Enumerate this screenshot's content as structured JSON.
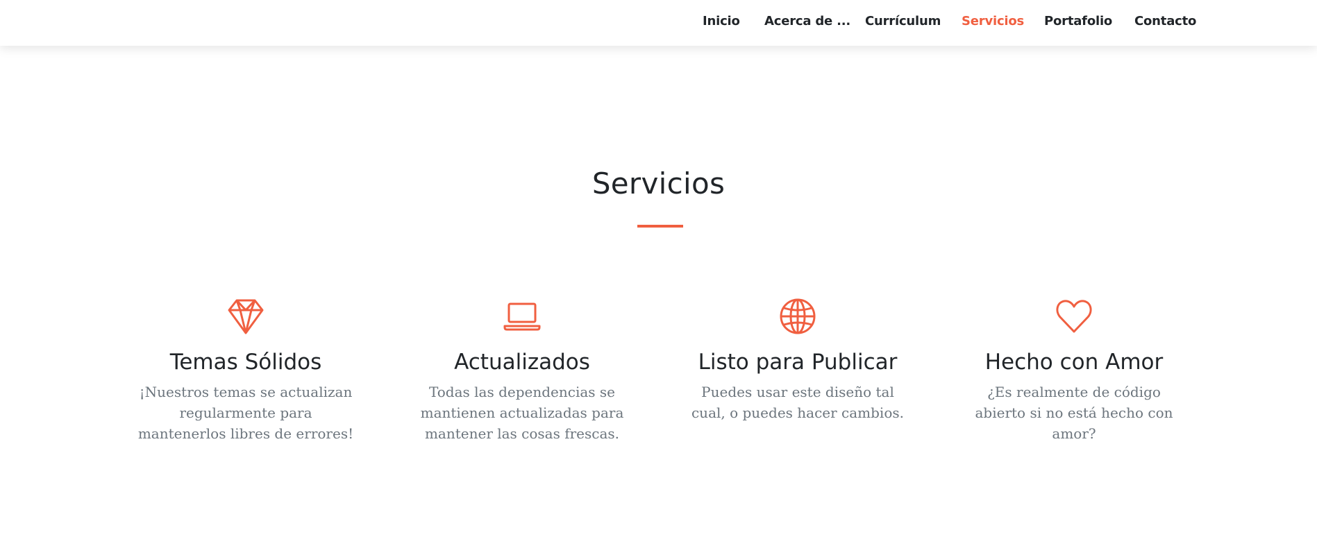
{
  "nav": {
    "items": [
      {
        "label": "Inicio",
        "active": false
      },
      {
        "label": "Acerca de ...",
        "active": false
      },
      {
        "label": "Currículum",
        "active": false
      },
      {
        "label": "Servicios",
        "active": true
      },
      {
        "label": "Portafolio",
        "active": false
      },
      {
        "label": "Contacto",
        "active": false
      }
    ]
  },
  "section": {
    "title": "Servicios"
  },
  "services": [
    {
      "icon": "diamond-icon",
      "title": "Temas Sólidos",
      "text": "¡Nuestros temas se actualizan regularmente para mantenerlos libres de errores!"
    },
    {
      "icon": "laptop-icon",
      "title": "Actualizados",
      "text": "Todas las dependencias se mantienen actualizadas para mantener las cosas frescas."
    },
    {
      "icon": "globe-icon",
      "title": "Listo para Publicar",
      "text": "Puedes usar este diseño tal cual, o puedes hacer cambios."
    },
    {
      "icon": "heart-icon",
      "title": "Hecho con Amor",
      "text": "¿Es realmente de código abierto si no está hecho con amor?"
    }
  ],
  "colors": {
    "accent": "#f05f40",
    "text": "#212529",
    "muted": "#6c757d"
  }
}
